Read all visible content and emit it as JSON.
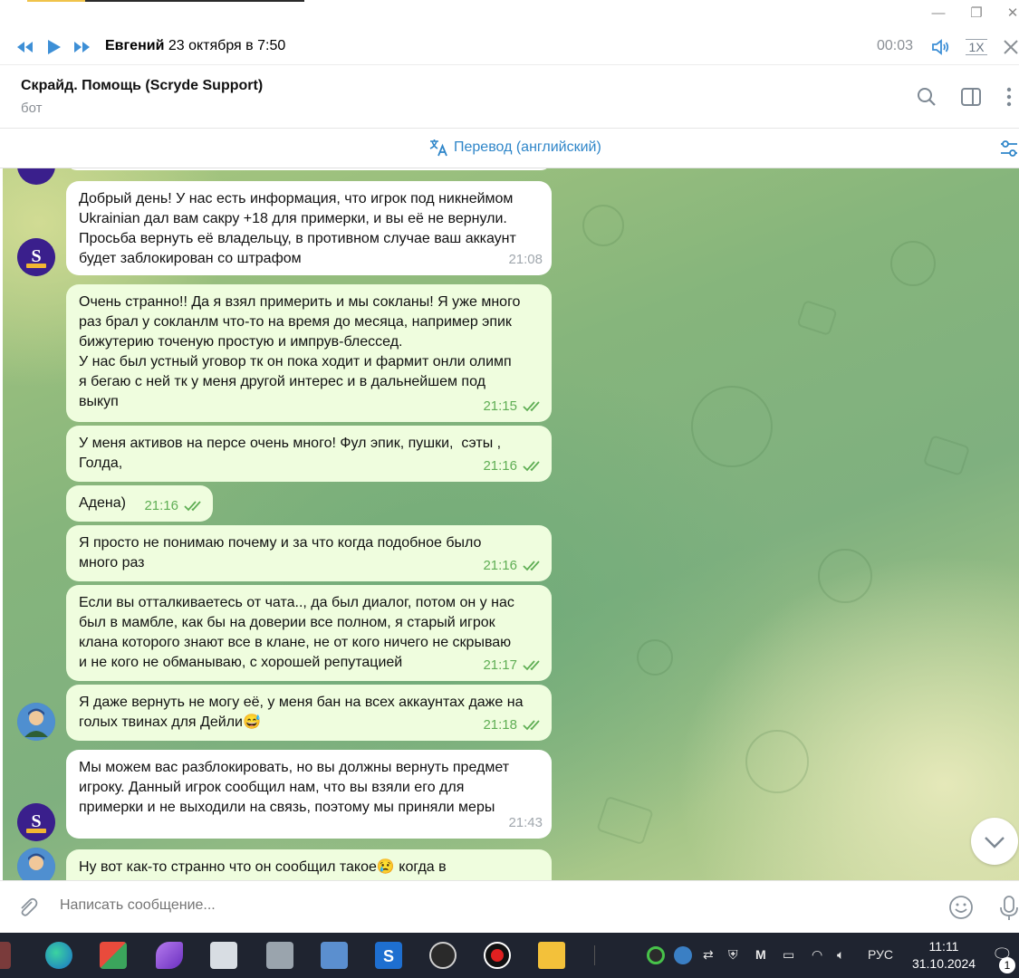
{
  "player": {
    "author": "Евгений",
    "date": "23 октября в 7:50",
    "elapsed": "00:03",
    "speed": "1X"
  },
  "header": {
    "title": "Скрайд. Помощь (Scryde Support)",
    "status": "бот"
  },
  "translate_bar": {
    "label": "Перевод (английский)"
  },
  "messages": [
    {
      "from": "bot",
      "text": "Добрый день! У нас есть информация, что игрок под никнеймом\nUkrainian дал вам сакру +18 для примерки, и вы её не вернули.\nПросьба вернуть её владельцу, в противном случае ваш аккаунт\nбудет заблокирован со штрафом",
      "time": "21:08"
    },
    {
      "from": "me",
      "text": "Очень странно!! Да я взял примерить и мы сокланы! Я уже много\nраз брал у сокланлм что-то на время до месяца, например эпик\nбижутерию точеную простую и импрув-блессед.\nУ нас был устный уговор тк он пока ходит и фармит онли олимп\nя бегаю с ней тк у меня другой интерес и в дальнейшем под\nвыкуп",
      "time": "21:15"
    },
    {
      "from": "me",
      "text": "У меня активов на персе очень много! Фул эпик, пушки,  сэты ,\nГолда,",
      "time": "21:16"
    },
    {
      "from": "me",
      "text": "Адена)",
      "time": "21:16"
    },
    {
      "from": "me",
      "text": "Я просто не понимаю почему и за что когда подобное было\nмного раз",
      "time": "21:16"
    },
    {
      "from": "me",
      "text": "Если вы отталкиваетесь от чата.., да был диалог, потом он у нас\nбыл в мамбле, как бы на доверии все полном, я старый игрок\nклана которого знают все в клане, не от кого ничего не скрываю\nи не кого не обманываю, с хорошей репутацией",
      "time": "21:17"
    },
    {
      "from": "me",
      "text": "Я даже вернуть не могу её, у меня бан на всех аккаунтах даже на\nголых твинах для Дейли😅",
      "time": "21:18"
    },
    {
      "from": "bot",
      "text": "Мы можем вас разблокировать, но вы должны вернуть предмет\nигроку. Данный игрок сообщил нам, что вы взяли его для\nпримерки и не выходили на связь, поэтому мы приняли меры",
      "time": "21:43"
    },
    {
      "from": "me",
      "text": "Ну вот как-то странно что он сообщил такое😢 когда в",
      "time": ""
    }
  ],
  "composer": {
    "placeholder": "Написать сообщение..."
  },
  "taskbar": {
    "language": "РУС",
    "time": "11:11",
    "date": "31.10.2024",
    "notification_count": "1"
  },
  "colors": {
    "accent": "#2f86c9",
    "outgoing_bubble": "#effdde",
    "incoming_bubble": "#ffffff",
    "read_check": "#5fae54",
    "taskbar": "#1f2430"
  }
}
